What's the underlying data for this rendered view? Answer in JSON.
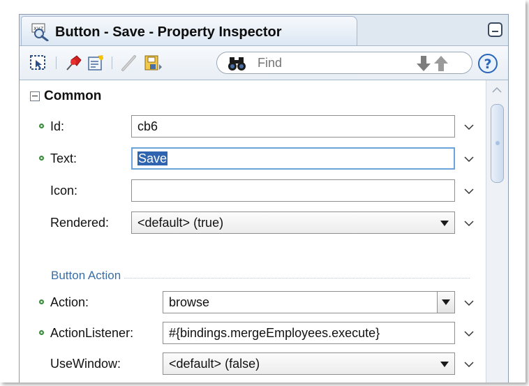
{
  "panel": {
    "title": "Button - Save - Property Inspector"
  },
  "toolbar": {
    "find_placeholder": "Find"
  },
  "sections": {
    "common": {
      "title": "Common",
      "rows": [
        {
          "label": "Id:",
          "value": "cb6",
          "required": true,
          "type": "text"
        },
        {
          "label": "Text:",
          "value": "Save",
          "required": true,
          "type": "text",
          "focused": true
        },
        {
          "label": "Icon:",
          "value": "",
          "required": false,
          "type": "text"
        },
        {
          "label": "Rendered:",
          "value": "<default> (true)",
          "required": false,
          "type": "select"
        }
      ]
    },
    "button_action": {
      "title": "Button Action",
      "rows": [
        {
          "label": "Action:",
          "value": "browse",
          "required": true,
          "type": "combo"
        },
        {
          "label": "ActionListener:",
          "value": "#{bindings.mergeEmployees.execute}",
          "required": true,
          "type": "text"
        },
        {
          "label": "UseWindow:",
          "value": "<default> (false)",
          "required": false,
          "type": "select"
        }
      ]
    }
  },
  "icons": [
    "property-inspector-icon",
    "select-component-icon",
    "pin-icon",
    "edit-properties-icon",
    "pencil-icon",
    "save-icon",
    "binoculars-icon",
    "arrow-down-icon",
    "arrow-up-icon",
    "help-icon",
    "minimize-icon",
    "chevron-down-icon"
  ],
  "colors": {
    "accent": "#2f64b0",
    "focus_border": "#6aa4dc",
    "required_dot": "#3b8a3b",
    "subsection_text": "#3a6ea5"
  }
}
